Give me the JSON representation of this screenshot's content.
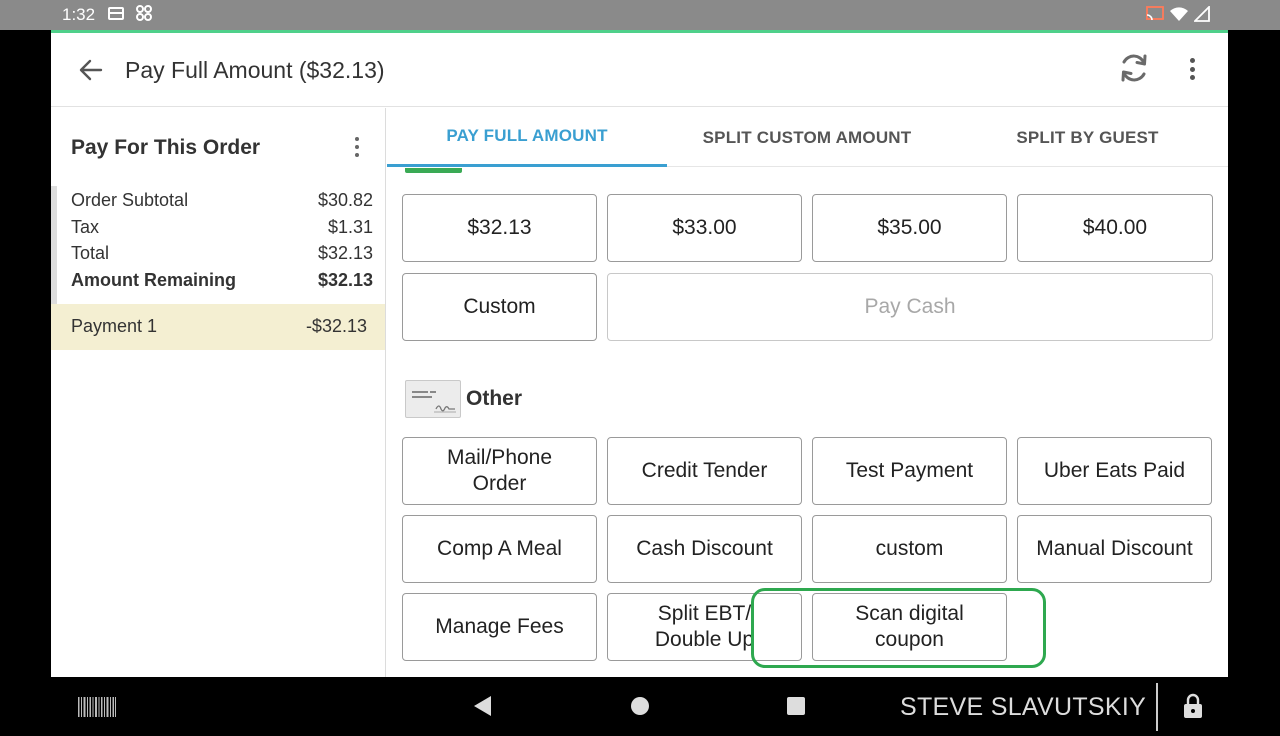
{
  "status_bar": {
    "time": "1:32",
    "icons": [
      "card-icon",
      "clover-icon",
      "cast-icon",
      "wifi-icon",
      "signal-icon"
    ]
  },
  "app_bar": {
    "title": "Pay Full Amount ($32.13)",
    "icons": [
      "back-arrow-icon",
      "refresh-icon",
      "more-vert-icon"
    ]
  },
  "order_panel": {
    "title": "Pay For This Order",
    "summary": [
      {
        "label": "Order Subtotal",
        "value": "$30.82",
        "bold": false
      },
      {
        "label": "Tax",
        "value": "$1.31",
        "bold": false
      },
      {
        "label": "Total",
        "value": "$32.13",
        "bold": false
      },
      {
        "label": "Amount Remaining",
        "value": "$32.13",
        "bold": true
      }
    ],
    "payment": {
      "label": "Payment 1",
      "value": "-$32.13"
    }
  },
  "tabs": [
    {
      "label": "PAY FULL AMOUNT",
      "active": true
    },
    {
      "label": "SPLIT CUSTOM AMOUNT",
      "active": false
    },
    {
      "label": "SPLIT BY GUEST",
      "active": false
    }
  ],
  "cash": {
    "amounts": [
      "$32.13",
      "$33.00",
      "$35.00",
      "$40.00"
    ],
    "custom_label": "Custom",
    "pay_cash_label": "Pay Cash"
  },
  "other": {
    "heading": "Other",
    "icon": "check-icon",
    "tenders": [
      [
        "Mail/Phone",
        "Order"
      ],
      [
        "Credit Tender"
      ],
      [
        "Test Payment"
      ],
      [
        "Uber Eats Paid"
      ],
      [
        "Comp A Meal"
      ],
      [
        "Cash Discount"
      ],
      [
        "custom"
      ],
      [
        "Manual Discount"
      ],
      [
        "Manage Fees"
      ],
      [
        "Split EBT/",
        "Double Up"
      ],
      [
        "Scan digital",
        "coupon"
      ]
    ],
    "highlighted": "Scan digital coupon",
    "highlight_color": "#2ea84f"
  },
  "nav_bar": {
    "user": "STEVE SLAVUTSKIY",
    "icons": [
      "barcode-icon",
      "nav-back-icon",
      "nav-home-icon",
      "nav-recents-icon",
      "lock-icon"
    ]
  },
  "colors": {
    "accent": "#3a9fd1",
    "status_bar": "#8a8a8a",
    "payment_row": "#f4efd2"
  }
}
